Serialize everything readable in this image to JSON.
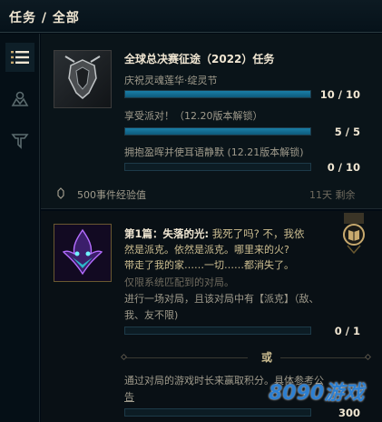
{
  "header": {
    "title": "任务 / 全部"
  },
  "sidebar": {
    "items": [
      {
        "icon": "list-icon",
        "active": true
      },
      {
        "icon": "team-icon",
        "active": false
      },
      {
        "icon": "tft-icon",
        "active": false
      }
    ]
  },
  "quest1": {
    "title": "全球总决赛征途（2022）任务",
    "objectives": [
      {
        "label": "庆祝灵魂莲华·绽灵节",
        "count": "10 / 10",
        "progress": 1.0
      },
      {
        "label": "享受派对！（12.20版本解锁）",
        "count": "5 / 5",
        "progress": 1.0
      },
      {
        "label": "拥抱盈晖并使耳语静默 (12.21版本解锁)",
        "count": "0 / 10",
        "progress": 0.0
      }
    ],
    "reward": "500事件经验值",
    "time_left": "11天 剩余"
  },
  "quest2": {
    "title_prefix": "第1篇：失落的光:",
    "title_rest_line1": " 我死了吗? 不，我依",
    "title_line2": "然是派克。依然是派克。哪里来的火?",
    "title_line3": "带走了我的家……一切……都消失了。",
    "note": "仅限系统匹配到的对局。",
    "objective_line1": "进行一场对局，且该对局中有【派克】（敌、",
    "objective_line2": "我、友不限)",
    "count1": "0 / 1",
    "progress1": 0.0,
    "or_label": "或",
    "objective2_line1": "通过对局的游戏时长来赢取积分。具体参考公",
    "objective2_line2": "告",
    "count2": "300"
  },
  "watermark": {
    "text": "8090游戏"
  }
}
